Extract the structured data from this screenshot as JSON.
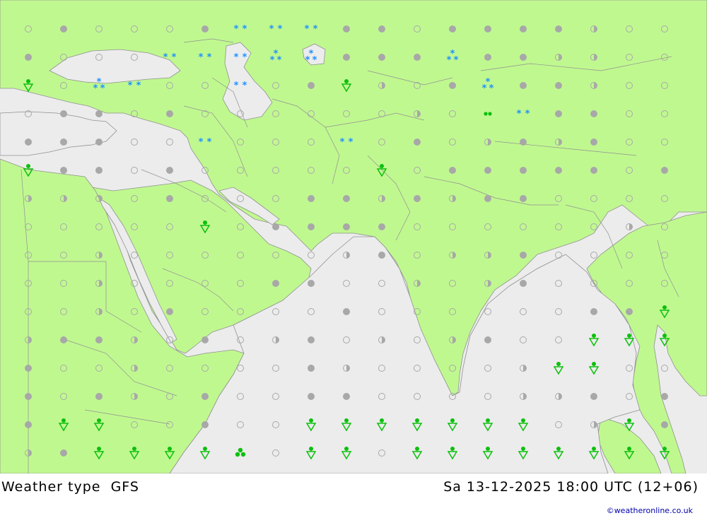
{
  "title": {
    "product": "Weather type",
    "model": "GFS",
    "datetime": "Sa 13-12-2025 18:00 UTC (12+06)"
  },
  "credit": "©weatheronline.co.uk",
  "colors": {
    "land": "#c0f890",
    "water": "#ececec",
    "border": "#909090",
    "cloud_full": "#a8a8a8",
    "cloud_outline": "#a8a8a8",
    "snow": "#1e90ff",
    "rain": "#0cc00c",
    "shower": "#0cc00c"
  },
  "grid": {
    "columns": 20,
    "rows": 16
  },
  "symbols": [
    "E E E E S S S O E E E E F O O O O F F O O",
    "F F E E E E E O S S F F F F F O O O O O",
    "F F F E E F E S S P P F F F F O O O O O",
    "O O O E E F O O O O O O O F F F O O O F",
    "O O O O O O O O O O O O O O O O O O O O"
  ],
  "legend_symbols": {
    "F": "full-cloud",
    "H": "half-cloud",
    "E": "empty-cloud",
    "S": "snow",
    "P": "snow-pellets",
    "R": "rain-shower",
    "D": "drizzle",
    "C": "cumulus-shower"
  }
}
